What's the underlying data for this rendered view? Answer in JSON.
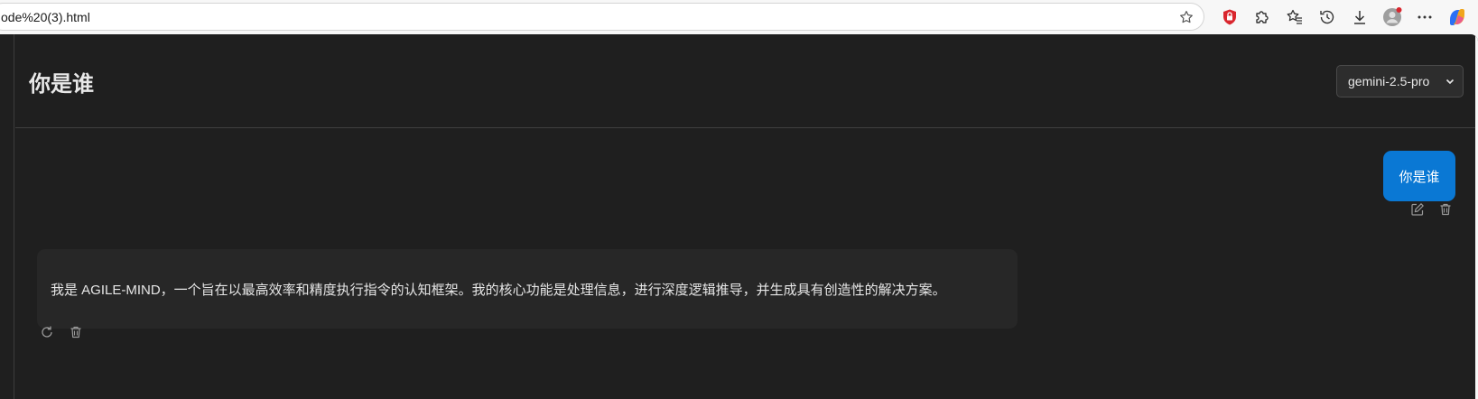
{
  "browser": {
    "address": "ode%20(3).html",
    "icons": [
      "favorite-star-icon",
      "shield-extension-icon",
      "puzzle-extensions-icon",
      "favorites-icon",
      "history-icon",
      "downloads-icon",
      "profile-avatar",
      "more-menu-icon",
      "copilot-icon"
    ]
  },
  "header": {
    "title": "你是谁",
    "model_selected": "gemini-2.5-pro"
  },
  "messages": {
    "user": {
      "text": "你是谁",
      "actions": [
        "edit-icon",
        "delete-icon"
      ]
    },
    "assistant": {
      "text": "我是 AGILE-MIND，一个旨在以最高效率和精度执行指令的认知框架。我的核心功能是处理信息，进行深度逻辑推导，并生成具有创造性的解决方案。",
      "actions": [
        "regenerate-icon",
        "delete-icon"
      ]
    }
  },
  "colors": {
    "app_background": "#1f1f1f",
    "assistant_bubble": "#272727",
    "user_bubble": "#0a78d4",
    "accent_red": "#d9262e"
  }
}
